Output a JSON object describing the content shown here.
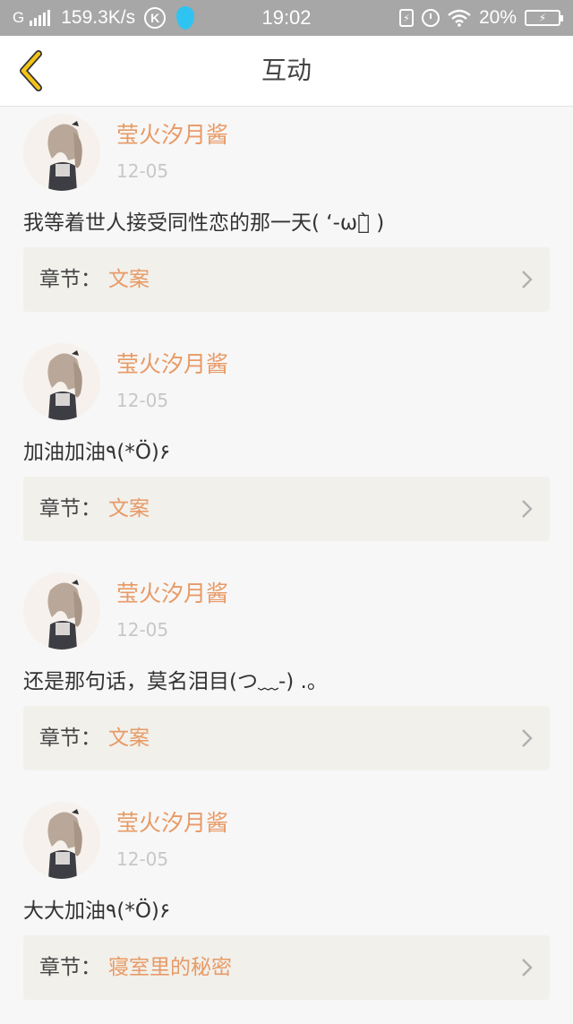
{
  "status_bar": {
    "carrier": "G",
    "speed": "159.3K/s",
    "k_badge": "K",
    "time": "19:02",
    "battery": "20%",
    "icons": [
      "signal-icon",
      "k-app-icon",
      "droplet-app-icon",
      "sim-flash-icon",
      "alarm-icon",
      "wifi-icon",
      "battery-charging-icon"
    ]
  },
  "nav": {
    "title": "互动",
    "back_icon": "chevron-left-icon"
  },
  "comments": [
    {
      "username": "莹火汐月酱",
      "date": "12-05",
      "text": "我等着世人接受同性恋的那一天( ‘-ωก̀ )",
      "chapter_label": "章节：",
      "chapter_name": "文案"
    },
    {
      "username": "莹火汐月酱",
      "date": "12-05",
      "text": "加油加油٩(*Ö)۶",
      "chapter_label": "章节：",
      "chapter_name": "文案"
    },
    {
      "username": "莹火汐月酱",
      "date": "12-05",
      "text": "还是那句话，莫名泪目(つ﹏-) .。",
      "chapter_label": "章节：",
      "chapter_name": "文案"
    },
    {
      "username": "莹火汐月酱",
      "date": "12-05",
      "text": "大大加油٩(*Ö)۶",
      "chapter_label": "章节：",
      "chapter_name": "寝室里的秘密"
    }
  ],
  "colors": {
    "accent": "#e89a66",
    "status_bar": "#a7a7a7",
    "droplet": "#2fc3f2",
    "back_arrow": "#f3c319"
  }
}
